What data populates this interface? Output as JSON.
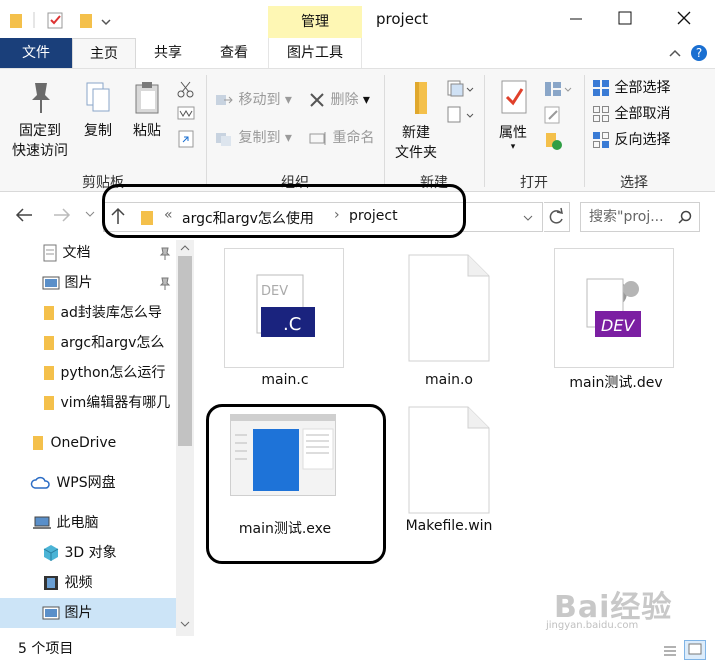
{
  "title_bar": {
    "manage_tab": "管理",
    "folder_name": "project"
  },
  "ribbon_tabs": {
    "file": "文件",
    "home": "主页",
    "share": "共享",
    "view": "查看",
    "picture_tools": "图片工具"
  },
  "ribbon": {
    "clipboard": {
      "pin": "固定到\n快速访问",
      "copy": "复制",
      "paste": "粘贴",
      "label": "剪贴板"
    },
    "organize": {
      "move_to": "移动到",
      "copy_to": "复制到",
      "delete": "删除",
      "rename": "重命名",
      "label": "组织"
    },
    "new": {
      "new_folder": "新建\n文件夹",
      "label": "新建"
    },
    "open": {
      "properties": "属性",
      "label": "打开"
    },
    "select": {
      "select_all": "全部选择",
      "select_none": "全部取消",
      "invert": "反向选择",
      "label": "选择"
    }
  },
  "address": {
    "prefix": "«",
    "path_parent": "argc和argv怎么使用",
    "separator": "›",
    "path_current": "project"
  },
  "search": {
    "placeholder": "搜索\"proj..."
  },
  "nav": {
    "items": [
      {
        "label": "文档"
      },
      {
        "label": "图片"
      },
      {
        "label": "ad封装库怎么导"
      },
      {
        "label": "argc和argv怎么"
      },
      {
        "label": "python怎么运行"
      },
      {
        "label": "vim编辑器有哪几"
      },
      {
        "label": "OneDrive"
      },
      {
        "label": "WPS网盘"
      },
      {
        "label": "此电脑"
      },
      {
        "label": "3D 对象"
      },
      {
        "label": "视频"
      },
      {
        "label": "图片"
      }
    ]
  },
  "files": [
    {
      "name": "main.c"
    },
    {
      "name": "main.o"
    },
    {
      "name": "main测试.dev"
    },
    {
      "name": "main测试.exe"
    },
    {
      "name": "Makefile.win"
    }
  ],
  "status": {
    "count": "5 个项目"
  },
  "watermark": "Bai经验",
  "watermark_sub": "jingyan.baidu.com",
  "colors": {
    "file_tab": "#1a3f7a",
    "manage_tab": "#fef7b4",
    "folder": "#f4c04b",
    "selected_nav": "#cce4f7"
  }
}
